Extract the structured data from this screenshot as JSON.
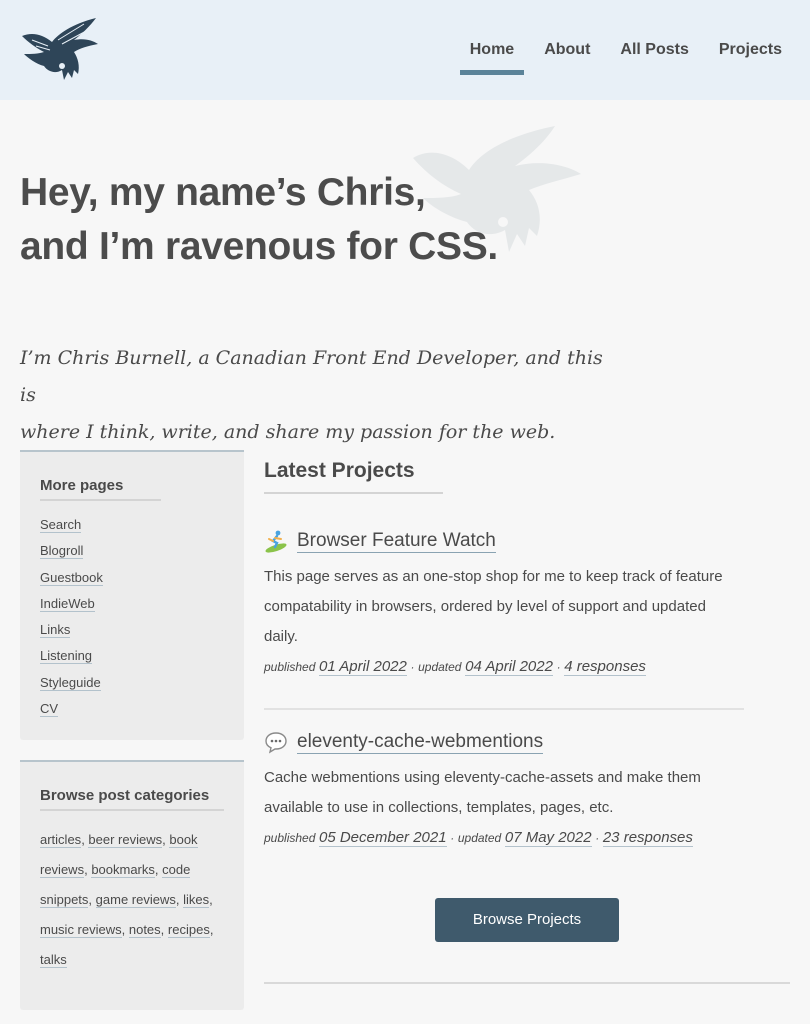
{
  "header": {
    "logo_icon": "raven-logo-icon",
    "nav": [
      {
        "label": "Home",
        "active": true
      },
      {
        "label": "About",
        "active": false
      },
      {
        "label": "All Posts",
        "active": false
      },
      {
        "label": "Projects",
        "active": false
      }
    ]
  },
  "hero": {
    "line1": "Hey, my name’s Chris,",
    "line2": "and I’m ravenous for CSS.",
    "intro_line1": "I’m Chris Burnell, a Canadian Front End Developer, and this is",
    "intro_line2": "where I think, write, and share my passion for the web."
  },
  "sidebar": {
    "more_pages_heading": "More pages",
    "pages": [
      "Search",
      "Blogroll",
      "Guestbook",
      "IndieWeb",
      "Links",
      "Listening",
      "Styleguide",
      "CV"
    ],
    "categories_heading": "Browse post categories",
    "categories": [
      "articles",
      "beer reviews",
      "book reviews",
      "bookmarks",
      "code snippets",
      "game reviews",
      "likes",
      "music reviews",
      "notes",
      "recipes",
      "talks"
    ]
  },
  "main": {
    "heading": "Latest Projects",
    "projects": [
      {
        "emoji": "surfer-icon",
        "title": "Browser Feature Watch",
        "description": "This page serves as an one-stop shop for me to keep track of feature compatability in browsers, ordered by level of support and updated daily.",
        "published_label": "published",
        "published": "01 April 2022",
        "updated_label": "updated",
        "updated": "04 April 2022",
        "responses": "4 responses"
      },
      {
        "emoji": "speech-bubble-icon",
        "title": "eleventy-cache-webmentions",
        "description": "Cache webmentions using eleventy-cache-assets and make them available to use in collections, templates, pages, etc.",
        "published_label": "published",
        "published": "05 December 2021",
        "updated_label": "updated",
        "updated": "07 May 2022",
        "responses": "23 responses"
      }
    ],
    "browse_button": "Browse Projects"
  },
  "colors": {
    "header_bg": "#e8f0f7",
    "accent": "#5b8399",
    "button_bg": "#3f5a6c",
    "page_bg": "#f7f7f7"
  }
}
